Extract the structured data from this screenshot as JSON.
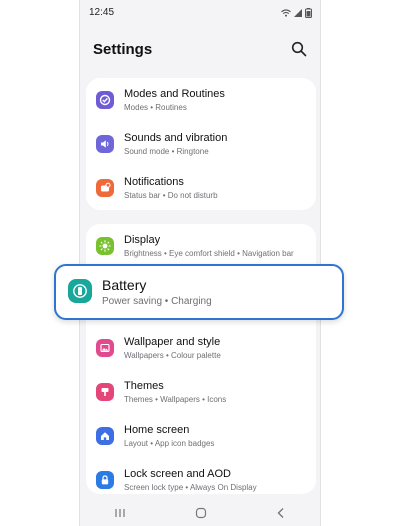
{
  "status_bar": {
    "time": "12:45"
  },
  "header": {
    "title": "Settings"
  },
  "groups": [
    [
      {
        "title": "Modes and Routines",
        "subtitle": "Modes • Routines",
        "icon": "check-circle-icon",
        "color": "#6f5bd6"
      },
      {
        "title": "Sounds and vibration",
        "subtitle": "Sound mode • Ringtone",
        "icon": "speaker-icon",
        "color": "#6f66d9"
      },
      {
        "title": "Notifications",
        "subtitle": "Status bar • Do not disturb",
        "icon": "bell-badge-icon",
        "color": "#ef6a3b"
      }
    ],
    [
      {
        "title": "Display",
        "subtitle": "Brightness • Eye comfort shield • Navigation bar",
        "icon": "sun-icon",
        "color": "#79c22f"
      }
    ],
    [
      {
        "title": "Wallpaper and style",
        "subtitle": "Wallpapers • Colour palette",
        "icon": "image-icon",
        "color": "#e14a8e"
      },
      {
        "title": "Themes",
        "subtitle": "Themes • Wallpapers • Icons",
        "icon": "brush-icon",
        "color": "#e5467a"
      },
      {
        "title": "Home screen",
        "subtitle": "Layout • App icon badges",
        "icon": "home-icon",
        "color": "#3c6fe3"
      },
      {
        "title": "Lock screen and AOD",
        "subtitle": "Screen lock type • Always On Display",
        "icon": "lock-icon",
        "color": "#2a7be3"
      }
    ]
  ],
  "highlight": {
    "title": "Battery",
    "subtitle": "Power saving • Charging",
    "icon": "battery-icon",
    "color": "#18a79a",
    "border_color": "#2f74d0"
  }
}
